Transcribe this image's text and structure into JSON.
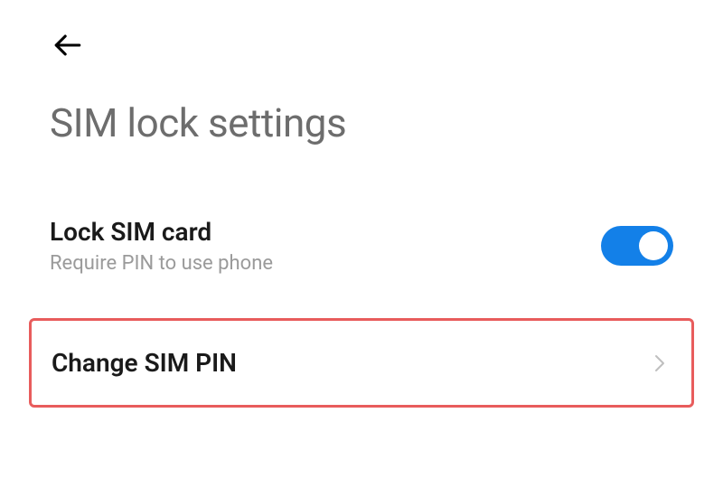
{
  "page": {
    "title": "SIM lock settings"
  },
  "settings": {
    "lockSim": {
      "label": "Lock SIM card",
      "description": "Require PIN to use phone",
      "enabled": true
    },
    "changePin": {
      "label": "Change SIM PIN"
    }
  },
  "colors": {
    "accent": "#1380e8",
    "highlight": "#e85c5c"
  }
}
